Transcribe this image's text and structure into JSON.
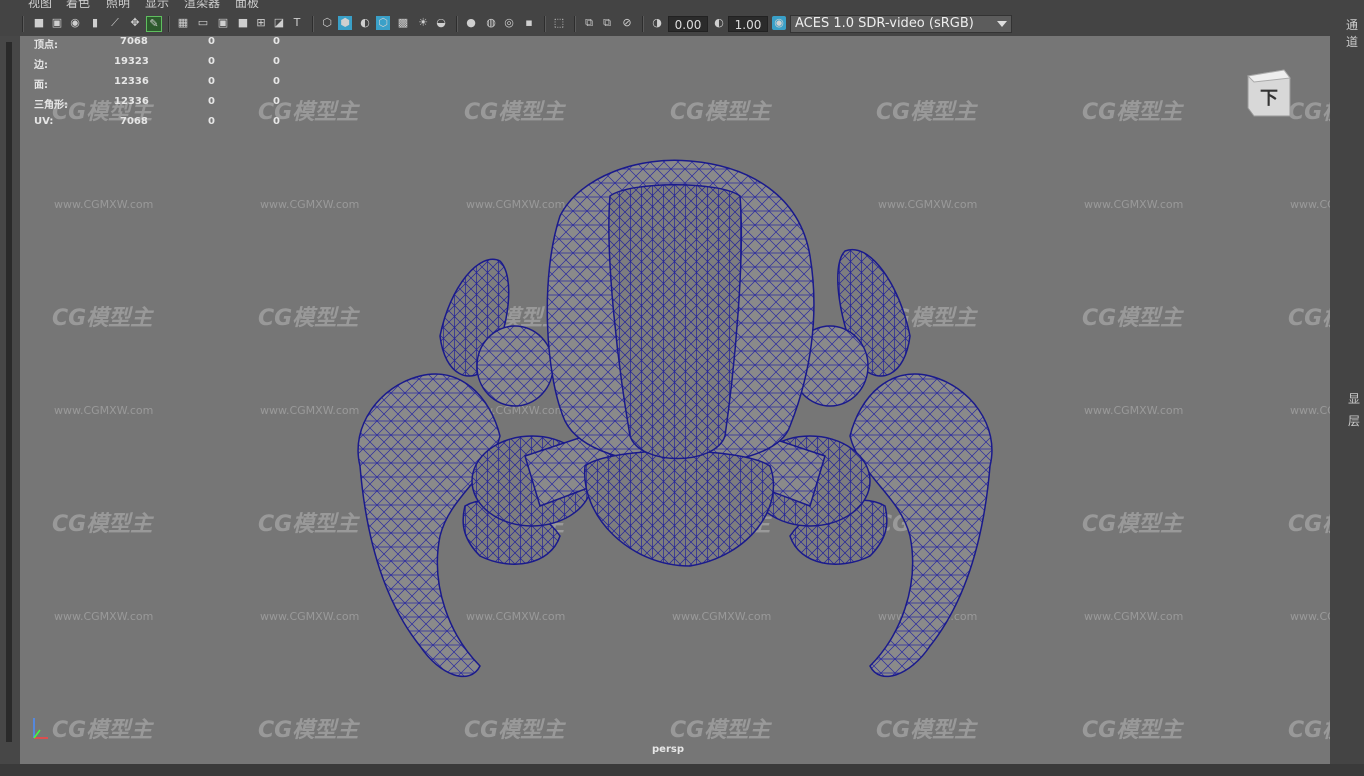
{
  "menu": [
    "视图",
    "着色",
    "照明",
    "显示",
    "渲染器",
    "面板"
  ],
  "toolbar": {
    "exposure": "0.00",
    "gamma": "1.00",
    "color_space": "ACES 1.0 SDR-video (sRGB)"
  },
  "hud": {
    "rows": [
      {
        "label": "顶点:",
        "total": "7068",
        "selected": "0",
        "component": "0"
      },
      {
        "label": "边:",
        "total": "19323",
        "selected": "0",
        "component": "0"
      },
      {
        "label": "面:",
        "total": "12336",
        "selected": "0",
        "component": "0"
      },
      {
        "label": "三角形:",
        "total": "12336",
        "selected": "0",
        "component": "0"
      },
      {
        "label": "UV:",
        "total": "7068",
        "selected": "0",
        "component": "0"
      }
    ]
  },
  "viewport": {
    "camera_label": "persp",
    "viewcube_face": "下",
    "background_color": "#767676",
    "wire_color": "#1a1a8c"
  },
  "watermark": {
    "logo": "CG模型主",
    "url": "www.CGMXW.com"
  },
  "right_panel": {
    "top_label": "通道",
    "tab_display": "显",
    "tab_layer": "层"
  }
}
